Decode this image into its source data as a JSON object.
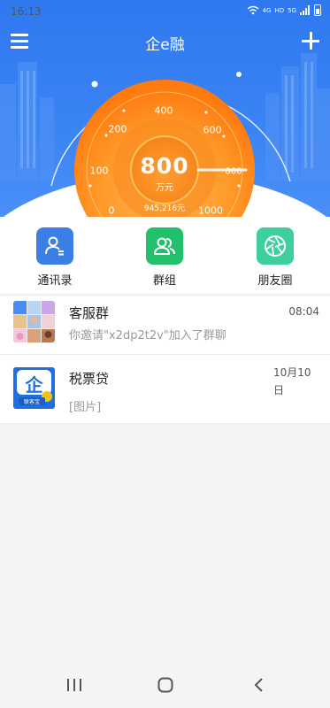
{
  "status_bar": {
    "time": "16:13",
    "network_tags": [
      "4G",
      "HD",
      "5G"
    ]
  },
  "nav": {
    "title": "企e融",
    "menu_icon": "menu-icon",
    "add_icon": "plus-icon"
  },
  "gauge": {
    "value": "800",
    "unit": "万元",
    "sub_value": "945,216元",
    "ticks": [
      "0",
      "100",
      "200",
      "400",
      "600",
      "800",
      "1000"
    ],
    "level_fraction": 0.8
  },
  "quick_actions": [
    {
      "label": "通讯录",
      "icon": "contacts-icon",
      "color": "#3a7ee6"
    },
    {
      "label": "群组",
      "icon": "group-icon",
      "color": "#22c06a"
    },
    {
      "label": "朋友圈",
      "icon": "moments-aperture-icon",
      "color": "#3ecf9f"
    }
  ],
  "chats": [
    {
      "name": "客服群",
      "message": "你邀请\"x2dp2t2v\"加入了群聊",
      "time": "08:04"
    },
    {
      "name": "税票贷",
      "message": "[图片]",
      "time": "10月10日",
      "avatar_text": "企",
      "avatar_caption": "联客宝"
    }
  ],
  "colors": {
    "brand_blue": "#3b84f4",
    "gauge_orange": "#ff8a1e"
  }
}
